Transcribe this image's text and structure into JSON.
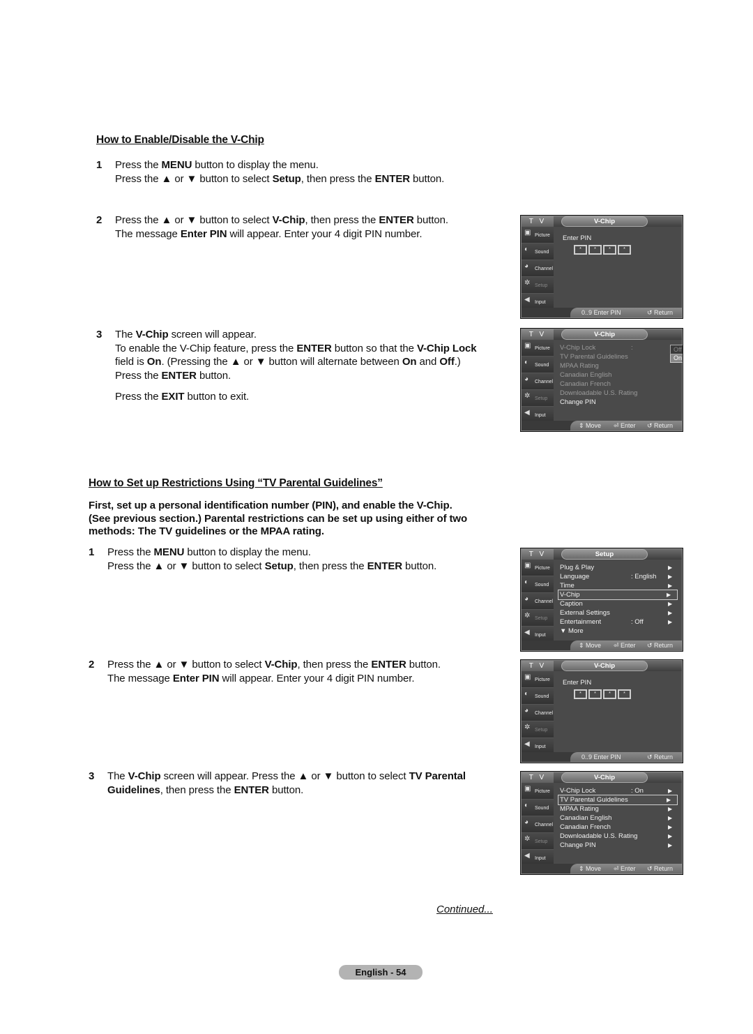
{
  "section1": {
    "heading": "How to Enable/Disable the V-Chip",
    "steps": [
      {
        "num": "1",
        "lines": [
          [
            {
              "t": "Press the "
            },
            {
              "t": "MENU",
              "b": true
            },
            {
              "t": " button to display the menu."
            }
          ],
          [
            {
              "t": "Press the ▲ or ▼ button to select "
            },
            {
              "t": "Setup",
              "b": true
            },
            {
              "t": ", then press the "
            },
            {
              "t": "ENTER",
              "b": true
            },
            {
              "t": " button."
            }
          ]
        ]
      },
      {
        "num": "2",
        "lines": [
          [
            {
              "t": "Press the ▲ or ▼ button to select "
            },
            {
              "t": "V-Chip",
              "b": true
            },
            {
              "t": ", then press the "
            },
            {
              "t": "ENTER",
              "b": true
            },
            {
              "t": " button."
            }
          ],
          [
            {
              "t": "The message "
            },
            {
              "t": "Enter PIN",
              "b": true
            },
            {
              "t": " will appear. Enter your 4 digit PIN number."
            }
          ]
        ]
      },
      {
        "num": "3",
        "lines": [
          [
            {
              "t": "The "
            },
            {
              "t": "V-Chip",
              "b": true
            },
            {
              "t": " screen will appear."
            }
          ],
          [
            {
              "t": "To enable the V-Chip feature, press the "
            },
            {
              "t": "ENTER",
              "b": true
            },
            {
              "t": " button so that the "
            },
            {
              "t": "V-Chip Lock",
              "b": true
            }
          ],
          [
            {
              "t": "field is "
            },
            {
              "t": "On",
              "b": true
            },
            {
              "t": ". (Pressing the ▲ or ▼ button will alternate between "
            },
            {
              "t": "On",
              "b": true
            },
            {
              "t": " and "
            },
            {
              "t": "Off",
              "b": true
            },
            {
              "t": ".)"
            }
          ],
          [
            {
              "t": "Press the "
            },
            {
              "t": "ENTER",
              "b": true
            },
            {
              "t": " button."
            }
          ],
          [
            {
              "t": ""
            }
          ],
          [
            {
              "t": "Press the "
            },
            {
              "t": "EXIT",
              "b": true
            },
            {
              "t": " button to exit."
            }
          ]
        ]
      }
    ]
  },
  "section2": {
    "heading": "How to Set up Restrictions Using “TV Parental Guidelines”",
    "intro": [
      "First, set up a personal identification number (PIN), and enable the V-Chip.",
      "(See previous section.) Parental restrictions can be set up using either of two",
      "methods: The TV guidelines or the MPAA rating."
    ],
    "steps": [
      {
        "num": "1",
        "lines": [
          [
            {
              "t": "Press the "
            },
            {
              "t": "MENU",
              "b": true
            },
            {
              "t": " button to display the menu."
            }
          ],
          [
            {
              "t": "Press the ▲ or ▼ button to select "
            },
            {
              "t": "Setup",
              "b": true
            },
            {
              "t": ", then press the "
            },
            {
              "t": "ENTER",
              "b": true
            },
            {
              "t": " button."
            }
          ]
        ]
      },
      {
        "num": "2",
        "lines": [
          [
            {
              "t": "Press the ▲ or ▼ button to select "
            },
            {
              "t": "V-Chip",
              "b": true
            },
            {
              "t": ", then press the "
            },
            {
              "t": "ENTER",
              "b": true
            },
            {
              "t": " button."
            }
          ],
          [
            {
              "t": "The message "
            },
            {
              "t": "Enter PIN",
              "b": true
            },
            {
              "t": " will appear. Enter your 4 digit PIN number."
            }
          ]
        ]
      },
      {
        "num": "3",
        "lines": [
          [
            {
              "t": "The "
            },
            {
              "t": "V-Chip",
              "b": true
            },
            {
              "t": " screen will appear. Press the ▲ or ▼ button to select "
            },
            {
              "t": "TV Parental",
              "b": true
            }
          ],
          [
            {
              "t": "Guidelines",
              "b": true
            },
            {
              "t": ", then press the "
            },
            {
              "t": "ENTER",
              "b": true
            },
            {
              "t": " button."
            }
          ]
        ]
      }
    ]
  },
  "osd_common": {
    "tv_label": "T V",
    "sidebar": [
      {
        "label": "Picture",
        "icon": "picture-icon",
        "glyph": "▣"
      },
      {
        "label": "Sound",
        "icon": "sound-icon",
        "glyph": "◐"
      },
      {
        "label": "Channel",
        "icon": "channel-icon",
        "glyph": "◕"
      },
      {
        "label": "Setup",
        "icon": "setup-icon",
        "glyph": "✲",
        "dim": true
      },
      {
        "label": "Input",
        "icon": "input-icon",
        "glyph": "◀"
      }
    ],
    "footer": {
      "digits": "0..9",
      "enter_pin": "Enter PIN",
      "move": "Move",
      "enter": "Enter",
      "return": "Return"
    }
  },
  "screens": [
    {
      "id": "osd-1",
      "type": "pin",
      "title": "V-Chip",
      "pin_label": "Enter PIN",
      "pin_digits": [
        "*",
        "*",
        "*",
        "*"
      ]
    },
    {
      "id": "osd-2",
      "type": "menu",
      "title": "V-Chip",
      "rows": [
        {
          "label": "V-Chip Lock",
          "value": ":",
          "dim": true,
          "arrow": false
        },
        {
          "label": "TV Parental Guidelines",
          "dim": true,
          "arrow": false
        },
        {
          "label": "MPAA Rating",
          "dim": true,
          "arrow": false
        },
        {
          "label": "Canadian English",
          "dim": true,
          "arrow": false
        },
        {
          "label": "Canadian French",
          "dim": true,
          "arrow": false
        },
        {
          "label": "Downloadable U.S. Rating",
          "dim": true,
          "arrow": false
        },
        {
          "label": "Change PIN",
          "dim": false,
          "arrow": false
        }
      ],
      "popup": [
        {
          "label": "Off",
          "dim": true
        },
        {
          "label": "On",
          "dim": false
        }
      ]
    },
    {
      "id": "osd-3",
      "type": "menu",
      "title": "Setup",
      "rows": [
        {
          "label": "Plug & Play",
          "arrow": true
        },
        {
          "label": "Language",
          "value": ": English",
          "arrow": true
        },
        {
          "label": "Time",
          "arrow": true
        },
        {
          "label": "V-Chip",
          "arrow": true,
          "selected": true
        },
        {
          "label": "Caption",
          "arrow": true
        },
        {
          "label": "External Settings",
          "arrow": true
        },
        {
          "label": "Entertainment",
          "value": ": Off",
          "arrow": true
        },
        {
          "label": "▼ More",
          "arrow": false
        }
      ]
    },
    {
      "id": "osd-4",
      "type": "pin",
      "title": "V-Chip",
      "pin_label": "Enter PIN",
      "pin_digits": [
        "*",
        "*",
        "*",
        "*"
      ]
    },
    {
      "id": "osd-5",
      "type": "menu",
      "title": "V-Chip",
      "rows": [
        {
          "label": "V-Chip Lock",
          "value": ": On",
          "arrow": true
        },
        {
          "label": "TV Parental Guidelines",
          "arrow": true,
          "selected": true
        },
        {
          "label": "MPAA Rating",
          "arrow": true
        },
        {
          "label": "Canadian English",
          "arrow": true
        },
        {
          "label": "Canadian French",
          "arrow": true
        },
        {
          "label": "Downloadable U.S. Rating",
          "arrow": true
        },
        {
          "label": "Change PIN",
          "arrow": true
        }
      ]
    }
  ],
  "footer": {
    "continued": "Continued...",
    "page_label": "English - 54"
  }
}
